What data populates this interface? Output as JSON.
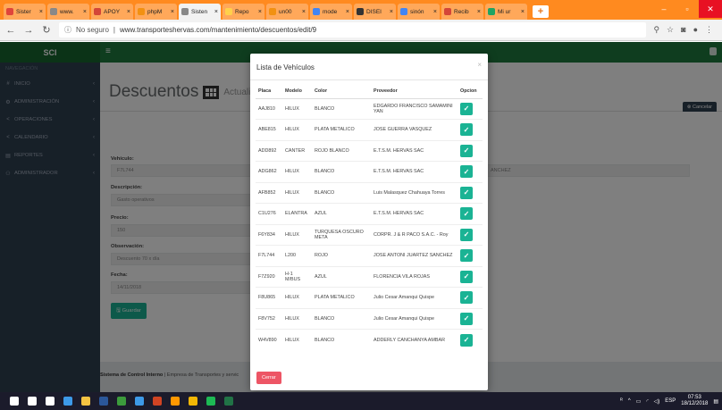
{
  "browser": {
    "tabs": [
      {
        "label": "Sister",
        "color": "#e0453b"
      },
      {
        "label": "www.",
        "color": "#888888"
      },
      {
        "label": "APOY",
        "color": "#d44638"
      },
      {
        "label": "phpM",
        "color": "#f29111"
      },
      {
        "label": "Sisten",
        "color": "#888888",
        "active": true
      },
      {
        "label": "Repo",
        "color": "#ffd04b"
      },
      {
        "label": "un00",
        "color": "#f29111"
      },
      {
        "label": "mode",
        "color": "#4285f4"
      },
      {
        "label": "DISEI",
        "color": "#333333"
      },
      {
        "label": "sinón",
        "color": "#4285f4"
      },
      {
        "label": "Recib",
        "color": "#d44638"
      },
      {
        "label": "Mi ur",
        "color": "#1fa463"
      }
    ],
    "tab_close": "×",
    "new_tab": "+",
    "window_controls": {
      "minimize": "–",
      "maximize": "▫",
      "close": "✕"
    },
    "secure_label": "No seguro",
    "url": "www.transporteshervas.com/mantenimiento/descuentos/edit/9"
  },
  "app": {
    "brand": "SCI",
    "sidebar": {
      "header": "NAVEGACIÓN",
      "items": [
        {
          "label": "INICIO",
          "icon": "#"
        },
        {
          "label": "ADMINISTRACIÓN",
          "icon": "⚙"
        },
        {
          "label": "OPERACIONES",
          "icon": "<"
        },
        {
          "label": "CALENDARIO",
          "icon": "<"
        },
        {
          "label": "REPORTES",
          "icon": "▤"
        },
        {
          "label": "ADMINISTRADOR",
          "icon": "⚇"
        }
      ]
    },
    "page": {
      "title": "Descuentos",
      "subtitle": "Actualizar R"
    },
    "cancel_label": "Cancelar",
    "form": {
      "vehicle_label": "Vehículo:",
      "vehicle_value": "F7L744",
      "vehicle_right": "ANCHEZ",
      "description_label": "Descripción:",
      "description_value": "Gasto operativos",
      "price_label": "Precio:",
      "price_value": "150",
      "observation_label": "Observación:",
      "observation_value": "Descuento 70 x día",
      "date_label": "Fecha:",
      "date_value": "14/11/2018",
      "save_label": "Guardar"
    },
    "footer": {
      "bold": "Sistema de Control Interno",
      "rest": " | Empresa de Transportes y servic"
    }
  },
  "modal": {
    "title": "Lista de Vehículos",
    "close": "×",
    "columns": [
      "Placa",
      "Modelo",
      "Color",
      "Proveedor",
      "Opcion"
    ],
    "rows": [
      [
        "AAJ810",
        "HILUX",
        "BLANCO",
        "EDGARDO FRANCISCO SAMAMINI YAN"
      ],
      [
        "ABE815",
        "HILUX",
        "PLATA METALICO",
        "JOSE GUERRA VASQUEZ"
      ],
      [
        "ADD892",
        "CANTER",
        "ROJO BLANCO",
        "E.T.S.M. HERVAS SAC"
      ],
      [
        "ADG862",
        "HILUX",
        "BLANCO",
        "E.T.S.M. HERVAS SAC"
      ],
      [
        "AFB852",
        "HILUX",
        "BLANCO",
        "Luis Malasquez Chahuaya Torres"
      ],
      [
        "C1U276",
        "ELANTRA",
        "AZUL",
        "E.T.S.M. HERVAS SAC"
      ],
      [
        "F6Y834",
        "HILUX",
        "TURQUESA OSCURO META",
        "CORPR. J & R PACO S.A.C. - Roy"
      ],
      [
        "F7L744",
        "L200",
        "ROJO",
        "JOSE ANTONI JUARTEZ SANCHEZ"
      ],
      [
        "F7Z920",
        "H-1 M/BUS",
        "AZUL",
        "FLORENCIA VILA ROJAS"
      ],
      [
        "F8U865",
        "HILUX",
        "PLATA METALICO",
        "Julio Cesar Amanqui Quispe"
      ],
      [
        "F8V752",
        "HILUX",
        "BLANCO",
        "Julio Cesar Amanqui Quispe"
      ],
      [
        "W4V890",
        "HILUX",
        "BLANCO",
        "ADDERLY CANCHANYA AMBAR"
      ]
    ],
    "select_glyph": "✓",
    "close_button": "Cerrar"
  },
  "taskbar": {
    "icons": [
      {
        "name": "windows-start-icon",
        "color": "#ffffff"
      },
      {
        "name": "search-icon",
        "color": "#ffffff"
      },
      {
        "name": "task-view-icon",
        "color": "#ffffff"
      },
      {
        "name": "dropbox-icon",
        "color": "#3d9ae8"
      },
      {
        "name": "file-explorer-icon",
        "color": "#f5c342"
      },
      {
        "name": "word-icon",
        "color": "#2b579a"
      },
      {
        "name": "green-app-icon",
        "color": "#3c9b3c"
      },
      {
        "name": "store-icon",
        "color": "#3d9ae8"
      },
      {
        "name": "powerpoint-icon",
        "color": "#d04423"
      },
      {
        "name": "sublime-icon",
        "color": "#ff9800"
      },
      {
        "name": "chrome-icon",
        "color": "#f2b705"
      },
      {
        "name": "spotify-icon",
        "color": "#1db954"
      },
      {
        "name": "excel-icon",
        "color": "#217346"
      }
    ],
    "lang": "ESP",
    "time": "07:53",
    "date": "18/12/2018"
  }
}
